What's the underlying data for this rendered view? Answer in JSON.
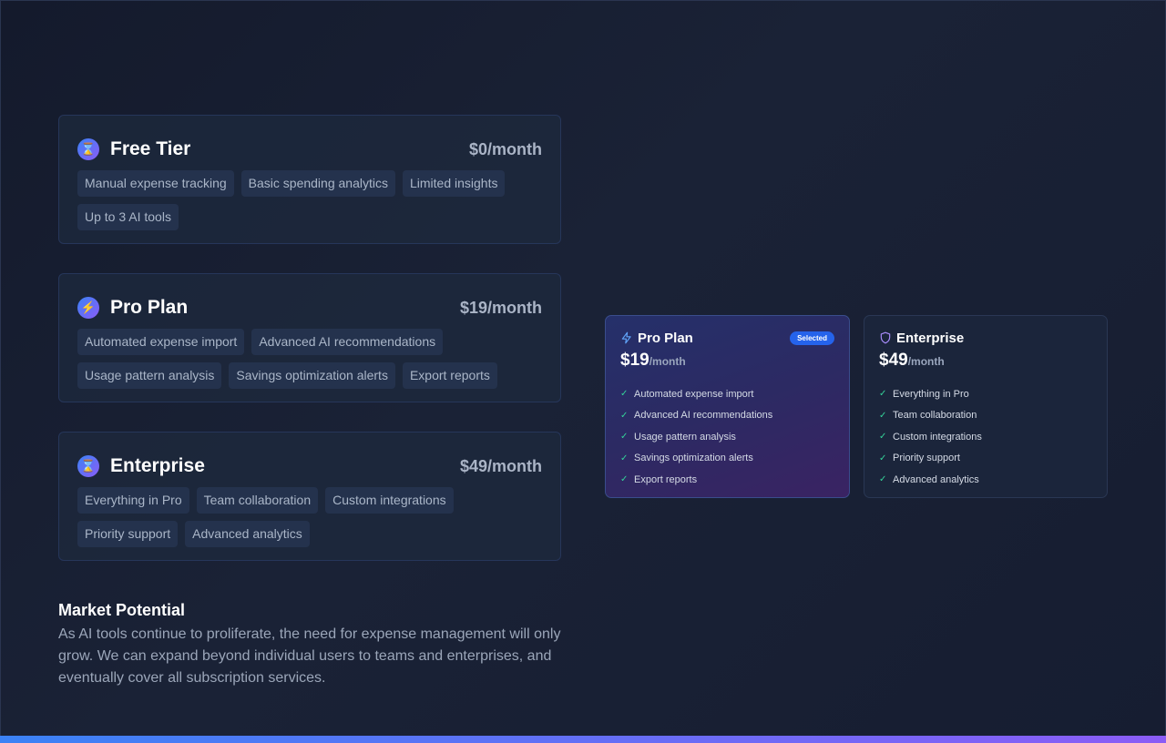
{
  "tiers": [
    {
      "name": "Free Tier",
      "price": "$0/month",
      "icon": "hourglass-icon",
      "features": [
        "Manual expense tracking",
        "Basic spending analytics",
        "Limited insights",
        "Up to 3 AI tools"
      ]
    },
    {
      "name": "Pro Plan",
      "price": "$19/month",
      "icon": "lightning-icon",
      "features": [
        "Automated expense import",
        "Advanced AI recommendations",
        "Usage pattern analysis",
        "Savings optimization alerts",
        "Export reports"
      ]
    },
    {
      "name": "Enterprise",
      "price": "$49/month",
      "icon": "hourglass-icon",
      "features": [
        "Everything in Pro",
        "Team collaboration",
        "Custom integrations",
        "Priority support",
        "Advanced analytics"
      ]
    }
  ],
  "market": {
    "title": "Market Potential",
    "body": "As AI tools continue to proliferate, the need for expense management will only grow. We can expand beyond individual users to teams and enterprises, and eventually cover all subscription services."
  },
  "plans": {
    "pro": {
      "name": "Pro Plan",
      "badge": "Selected",
      "price": "$19",
      "per": "/month",
      "icon": "lightning-icon",
      "features": [
        "Automated expense import",
        "Advanced AI recommendations",
        "Usage pattern analysis",
        "Savings optimization alerts",
        "Export reports"
      ]
    },
    "enterprise": {
      "name": "Enterprise",
      "price": "$49",
      "per": "/month",
      "icon": "shield-icon",
      "features": [
        "Everything in Pro",
        "Team collaboration",
        "Custom integrations",
        "Priority support",
        "Advanced analytics"
      ]
    }
  },
  "colors": {
    "accent_blue": "#3b82f6",
    "accent_purple": "#8b5cf6",
    "check_green": "#34d399",
    "badge_blue": "#2563eb"
  }
}
